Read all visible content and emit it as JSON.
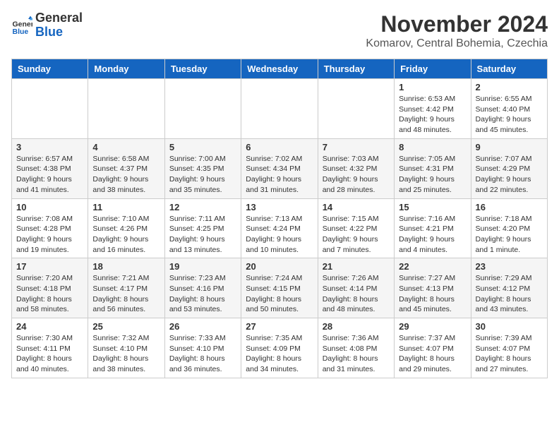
{
  "logo": {
    "line1": "General",
    "line2": "Blue"
  },
  "title": "November 2024",
  "location": "Komarov, Central Bohemia, Czechia",
  "weekdays": [
    "Sunday",
    "Monday",
    "Tuesday",
    "Wednesday",
    "Thursday",
    "Friday",
    "Saturday"
  ],
  "weeks": [
    [
      {
        "day": "",
        "info": ""
      },
      {
        "day": "",
        "info": ""
      },
      {
        "day": "",
        "info": ""
      },
      {
        "day": "",
        "info": ""
      },
      {
        "day": "",
        "info": ""
      },
      {
        "day": "1",
        "info": "Sunrise: 6:53 AM\nSunset: 4:42 PM\nDaylight: 9 hours and 48 minutes."
      },
      {
        "day": "2",
        "info": "Sunrise: 6:55 AM\nSunset: 4:40 PM\nDaylight: 9 hours and 45 minutes."
      }
    ],
    [
      {
        "day": "3",
        "info": "Sunrise: 6:57 AM\nSunset: 4:38 PM\nDaylight: 9 hours and 41 minutes."
      },
      {
        "day": "4",
        "info": "Sunrise: 6:58 AM\nSunset: 4:37 PM\nDaylight: 9 hours and 38 minutes."
      },
      {
        "day": "5",
        "info": "Sunrise: 7:00 AM\nSunset: 4:35 PM\nDaylight: 9 hours and 35 minutes."
      },
      {
        "day": "6",
        "info": "Sunrise: 7:02 AM\nSunset: 4:34 PM\nDaylight: 9 hours and 31 minutes."
      },
      {
        "day": "7",
        "info": "Sunrise: 7:03 AM\nSunset: 4:32 PM\nDaylight: 9 hours and 28 minutes."
      },
      {
        "day": "8",
        "info": "Sunrise: 7:05 AM\nSunset: 4:31 PM\nDaylight: 9 hours and 25 minutes."
      },
      {
        "day": "9",
        "info": "Sunrise: 7:07 AM\nSunset: 4:29 PM\nDaylight: 9 hours and 22 minutes."
      }
    ],
    [
      {
        "day": "10",
        "info": "Sunrise: 7:08 AM\nSunset: 4:28 PM\nDaylight: 9 hours and 19 minutes."
      },
      {
        "day": "11",
        "info": "Sunrise: 7:10 AM\nSunset: 4:26 PM\nDaylight: 9 hours and 16 minutes."
      },
      {
        "day": "12",
        "info": "Sunrise: 7:11 AM\nSunset: 4:25 PM\nDaylight: 9 hours and 13 minutes."
      },
      {
        "day": "13",
        "info": "Sunrise: 7:13 AM\nSunset: 4:24 PM\nDaylight: 9 hours and 10 minutes."
      },
      {
        "day": "14",
        "info": "Sunrise: 7:15 AM\nSunset: 4:22 PM\nDaylight: 9 hours and 7 minutes."
      },
      {
        "day": "15",
        "info": "Sunrise: 7:16 AM\nSunset: 4:21 PM\nDaylight: 9 hours and 4 minutes."
      },
      {
        "day": "16",
        "info": "Sunrise: 7:18 AM\nSunset: 4:20 PM\nDaylight: 9 hours and 1 minute."
      }
    ],
    [
      {
        "day": "17",
        "info": "Sunrise: 7:20 AM\nSunset: 4:18 PM\nDaylight: 8 hours and 58 minutes."
      },
      {
        "day": "18",
        "info": "Sunrise: 7:21 AM\nSunset: 4:17 PM\nDaylight: 8 hours and 56 minutes."
      },
      {
        "day": "19",
        "info": "Sunrise: 7:23 AM\nSunset: 4:16 PM\nDaylight: 8 hours and 53 minutes."
      },
      {
        "day": "20",
        "info": "Sunrise: 7:24 AM\nSunset: 4:15 PM\nDaylight: 8 hours and 50 minutes."
      },
      {
        "day": "21",
        "info": "Sunrise: 7:26 AM\nSunset: 4:14 PM\nDaylight: 8 hours and 48 minutes."
      },
      {
        "day": "22",
        "info": "Sunrise: 7:27 AM\nSunset: 4:13 PM\nDaylight: 8 hours and 45 minutes."
      },
      {
        "day": "23",
        "info": "Sunrise: 7:29 AM\nSunset: 4:12 PM\nDaylight: 8 hours and 43 minutes."
      }
    ],
    [
      {
        "day": "24",
        "info": "Sunrise: 7:30 AM\nSunset: 4:11 PM\nDaylight: 8 hours and 40 minutes."
      },
      {
        "day": "25",
        "info": "Sunrise: 7:32 AM\nSunset: 4:10 PM\nDaylight: 8 hours and 38 minutes."
      },
      {
        "day": "26",
        "info": "Sunrise: 7:33 AM\nSunset: 4:10 PM\nDaylight: 8 hours and 36 minutes."
      },
      {
        "day": "27",
        "info": "Sunrise: 7:35 AM\nSunset: 4:09 PM\nDaylight: 8 hours and 34 minutes."
      },
      {
        "day": "28",
        "info": "Sunrise: 7:36 AM\nSunset: 4:08 PM\nDaylight: 8 hours and 31 minutes."
      },
      {
        "day": "29",
        "info": "Sunrise: 7:37 AM\nSunset: 4:07 PM\nDaylight: 8 hours and 29 minutes."
      },
      {
        "day": "30",
        "info": "Sunrise: 7:39 AM\nSunset: 4:07 PM\nDaylight: 8 hours and 27 minutes."
      }
    ]
  ]
}
